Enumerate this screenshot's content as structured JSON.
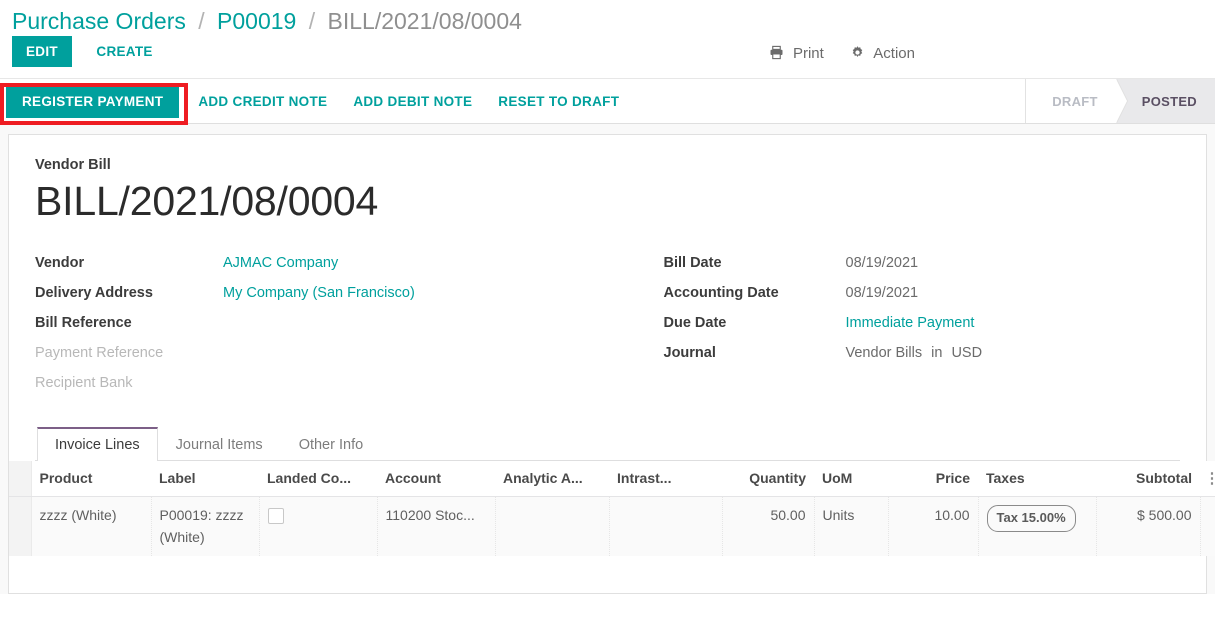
{
  "breadcrumb": {
    "root": "Purchase Orders",
    "parent": "P00019",
    "current": "BILL/2021/08/0004",
    "separator": "/"
  },
  "control_panel": {
    "edit_label": "EDIT",
    "create_label": "CREATE",
    "print_label": "Print",
    "print_icon": "printer-icon",
    "action_label": "Action",
    "action_icon": "gear-icon"
  },
  "statusbar": {
    "buttons": [
      {
        "label": "REGISTER PAYMENT",
        "primary": true,
        "highlighted": true
      },
      {
        "label": "ADD CREDIT NOTE",
        "primary": false,
        "highlighted": false
      },
      {
        "label": "ADD DEBIT NOTE",
        "primary": false,
        "highlighted": false
      },
      {
        "label": "RESET TO DRAFT",
        "primary": false,
        "highlighted": false
      }
    ],
    "stages": [
      {
        "label": "DRAFT",
        "active": false
      },
      {
        "label": "POSTED",
        "active": true
      }
    ],
    "highlight_color": "#ee1c22"
  },
  "sheet": {
    "subtitle": "Vendor Bill",
    "title": "BILL/2021/08/0004",
    "left_fields": [
      {
        "label": "Vendor",
        "value": "AJMAC Company",
        "link": true,
        "muted_label": false
      },
      {
        "label": "Delivery Address",
        "value": "My Company (San Francisco)",
        "link": true,
        "muted_label": false
      },
      {
        "label": "Bill Reference",
        "value": "",
        "link": false,
        "muted_label": false
      },
      {
        "label": "Payment Reference",
        "value": "",
        "link": false,
        "muted_label": true
      },
      {
        "label": "Recipient Bank",
        "value": "",
        "link": false,
        "muted_label": true
      }
    ],
    "right_fields": [
      {
        "label": "Bill Date",
        "value": "08/19/2021",
        "link": false,
        "muted_label": false
      },
      {
        "label": "Accounting Date",
        "value": "08/19/2021",
        "link": false,
        "muted_label": false
      },
      {
        "label": "Due Date",
        "value": "Immediate Payment",
        "link": true,
        "muted_label": false
      },
      {
        "label": "Journal",
        "value": "Vendor Bills",
        "link": true,
        "muted_label": false,
        "suffix_word": "in",
        "suffix_value": "USD"
      }
    ]
  },
  "notebook": {
    "tabs": [
      {
        "label": "Invoice Lines",
        "active": true
      },
      {
        "label": "Journal Items",
        "active": false
      },
      {
        "label": "Other Info",
        "active": false
      }
    ]
  },
  "lines_table": {
    "columns": [
      {
        "label": "Product",
        "align": "left"
      },
      {
        "label": "Label",
        "align": "left"
      },
      {
        "label": "Landed Co...",
        "align": "left"
      },
      {
        "label": "Account",
        "align": "left"
      },
      {
        "label": "Analytic A...",
        "align": "left"
      },
      {
        "label": "Intrast...",
        "align": "left"
      },
      {
        "label": "Quantity",
        "align": "right"
      },
      {
        "label": "UoM",
        "align": "left"
      },
      {
        "label": "Price",
        "align": "right"
      },
      {
        "label": "Taxes",
        "align": "left"
      },
      {
        "label": "Subtotal",
        "align": "right"
      }
    ],
    "optional_columns_icon": "vertical-dots-icon",
    "rows": [
      {
        "product": "zzzz (White)",
        "label": "P00019: zzzz (White)",
        "landed_costs_checked": false,
        "account": "110200 Stoc...",
        "analytic_account": "",
        "intrastat": "",
        "quantity": "50.00",
        "uom": "Units",
        "price": "10.00",
        "taxes": "Tax 15.00%",
        "subtotal": "$ 500.00"
      }
    ]
  }
}
